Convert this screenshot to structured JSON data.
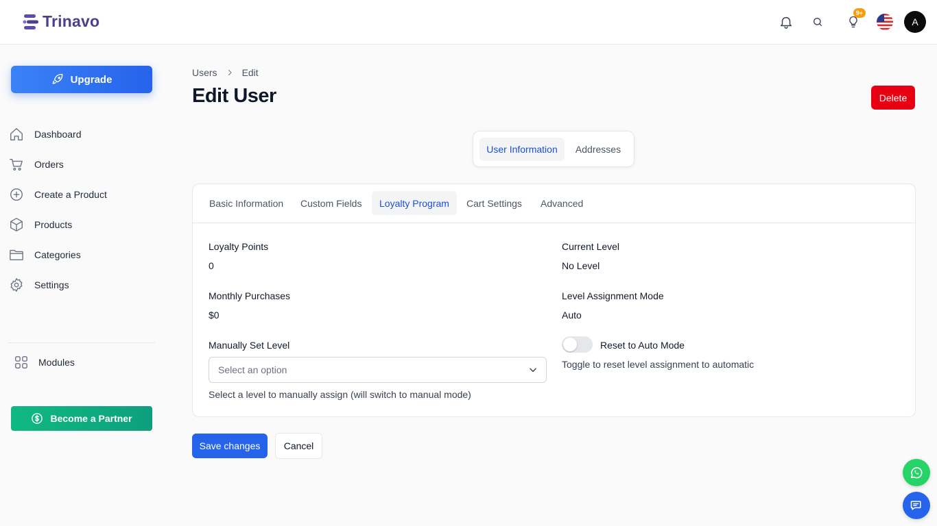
{
  "brand": {
    "name": "Trinavo"
  },
  "header": {
    "icons": [
      "bell-icon",
      "search-icon",
      "lightbulb-icon",
      "us-flag-icon"
    ],
    "badge": "9+",
    "avatar_initial": "A"
  },
  "sidebar": {
    "upgrade_label": "Upgrade",
    "items": [
      {
        "label": "Dashboard",
        "icon": "home-icon"
      },
      {
        "label": "Orders",
        "icon": "cart-icon"
      },
      {
        "label": "Create a Product",
        "icon": "plus-circle-icon"
      },
      {
        "label": "Products",
        "icon": "box-icon"
      },
      {
        "label": "Categories",
        "icon": "folder-icon"
      },
      {
        "label": "Settings",
        "icon": "gear-icon"
      }
    ],
    "modules_label": "Modules",
    "partner_label": "Become a Partner"
  },
  "breadcrumb": {
    "parent": "Users",
    "current": "Edit"
  },
  "page_title": "Edit User",
  "delete_label": "Delete",
  "segment_tabs": {
    "active": "User Information",
    "other": "Addresses"
  },
  "card_tabs": [
    "Basic Information",
    "Custom Fields",
    "Loyalty Program",
    "Cart Settings",
    "Advanced"
  ],
  "loyalty": {
    "points_label": "Loyalty Points",
    "points_value": "0",
    "current_level_label": "Current Level",
    "current_level_value": "No Level",
    "monthly_label": "Monthly Purchases",
    "monthly_value": "$0",
    "mode_label": "Level Assignment Mode",
    "mode_value": "Auto",
    "manual_label": "Manually Set Level",
    "manual_placeholder": "Select an option",
    "manual_hint": "Select a level to manually assign (will switch to manual mode)",
    "reset_label": "Reset to Auto Mode",
    "reset_hint": "Toggle to reset level assignment to automatic",
    "reset_on": false
  },
  "actions": {
    "save": "Save changes",
    "cancel": "Cancel"
  },
  "colors": {
    "primary": "#2563eb",
    "danger": "#e60012",
    "partner": "#10b981",
    "brand": "#4c3f8f"
  }
}
